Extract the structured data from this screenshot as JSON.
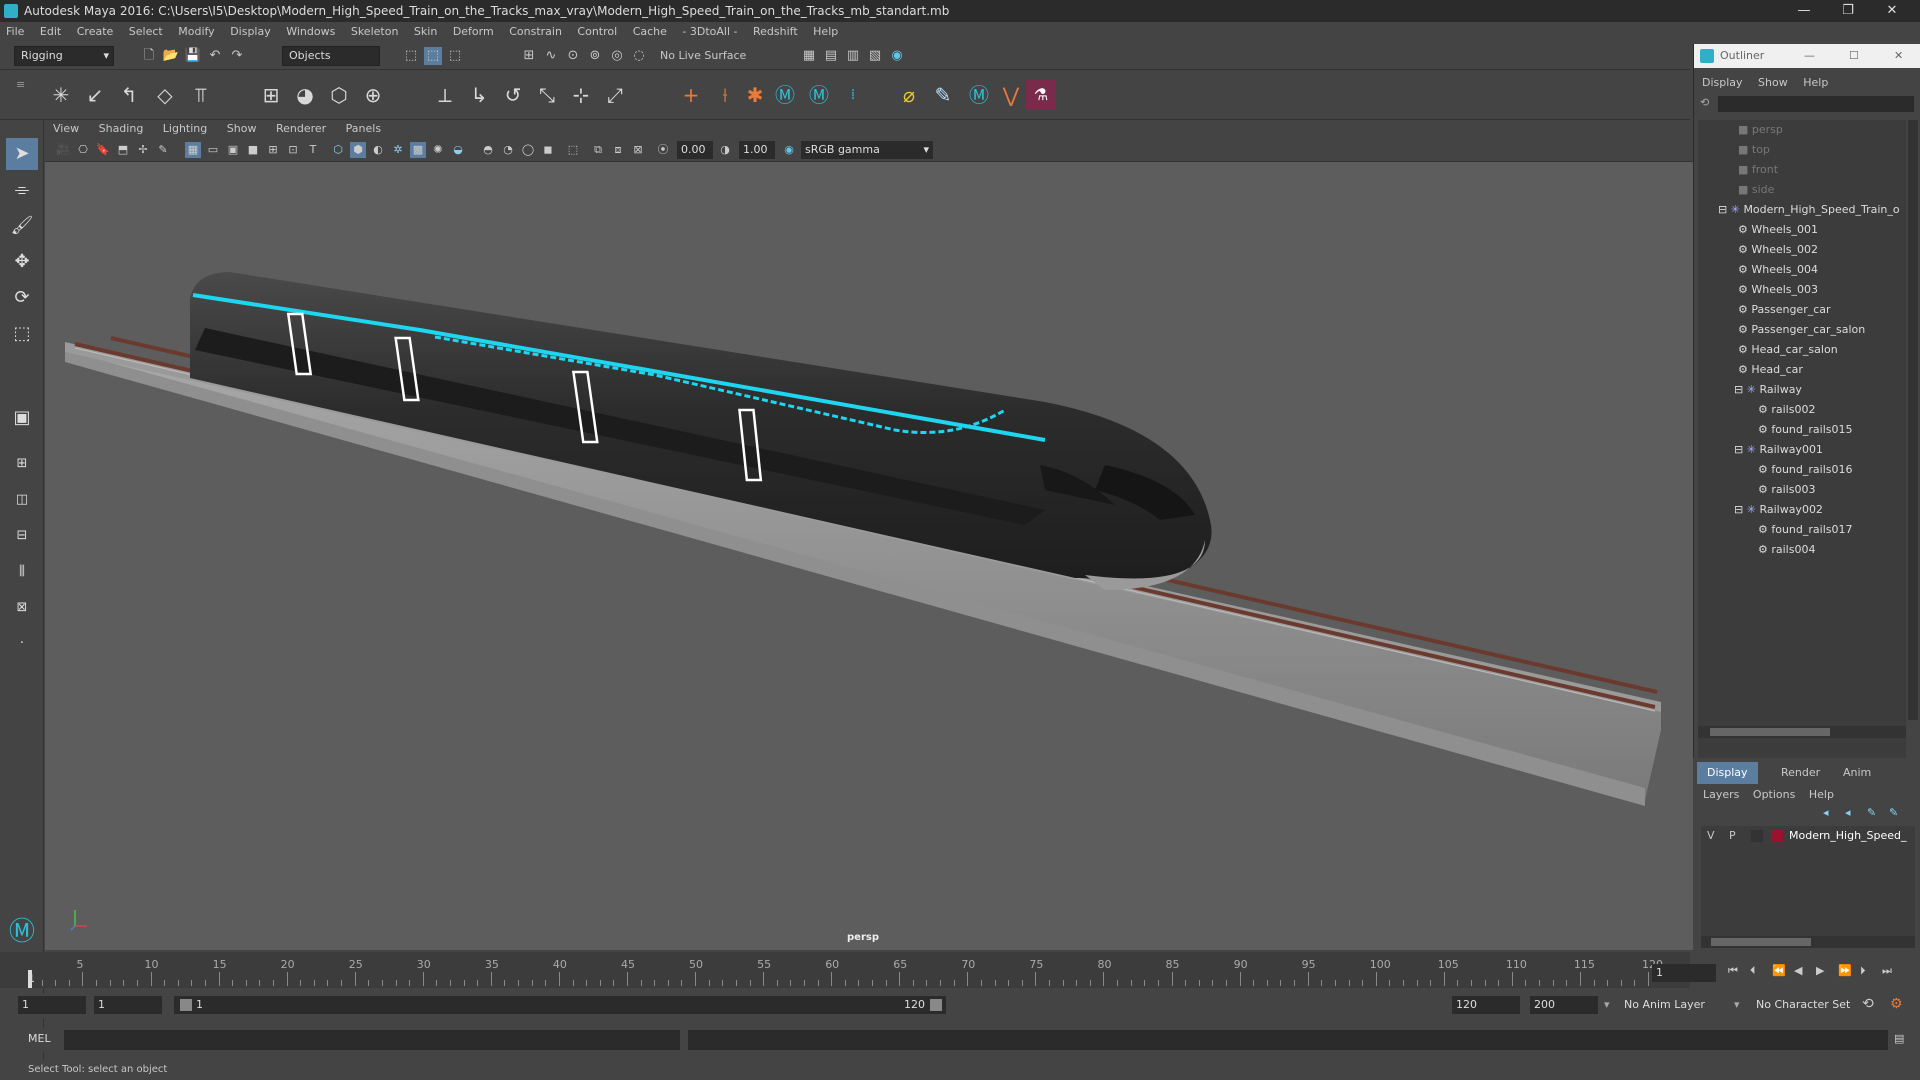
{
  "titlebar": {
    "title": "Autodesk Maya 2016: C:\\Users\\I5\\Desktop\\Modern_High_Speed_Train_on_the_Tracks_max_vray\\Modern_High_Speed_Train_on_the_Tracks_mb_standart.mb"
  },
  "menubar": [
    "File",
    "Edit",
    "Create",
    "Select",
    "Modify",
    "Display",
    "Windows",
    "Skeleton",
    "Skin",
    "Deform",
    "Constrain",
    "Control",
    "Cache",
    "- 3DtoAll -",
    "Redshift",
    "Help"
  ],
  "statusline": {
    "menuset": "Rigging",
    "selection_mode": "Objects",
    "live_surface": "No Live Surface"
  },
  "viewport": {
    "menu": [
      "View",
      "Shading",
      "Lighting",
      "Show",
      "Renderer",
      "Panels"
    ],
    "near_value": "0.00",
    "far_value": "1.00",
    "color_space": "sRGB gamma",
    "camera_label": "persp"
  },
  "outliner": {
    "title": "Outliner",
    "menu": [
      "Display",
      "Show",
      "Help"
    ],
    "items": [
      {
        "label": "persp",
        "dim": true
      },
      {
        "label": "top",
        "dim": true
      },
      {
        "label": "front",
        "dim": true
      },
      {
        "label": "side",
        "dim": true
      },
      {
        "label": "Modern_High_Speed_Train_o"
      },
      {
        "label": "Wheels_001"
      },
      {
        "label": "Wheels_002"
      },
      {
        "label": "Wheels_004"
      },
      {
        "label": "Wheels_003"
      },
      {
        "label": "Passenger_car"
      },
      {
        "label": "Passenger_car_salon"
      },
      {
        "label": "Head_car_salon"
      },
      {
        "label": "Head_car"
      },
      {
        "label": "Railway"
      },
      {
        "label": "rails002"
      },
      {
        "label": "found_rails015"
      },
      {
        "label": "Railway001"
      },
      {
        "label": "found_rails016"
      },
      {
        "label": "rails003"
      },
      {
        "label": "Railway002"
      },
      {
        "label": "found_rails017"
      },
      {
        "label": "rails004"
      }
    ]
  },
  "layers": {
    "tabs": [
      "Display",
      "Render",
      "Anim"
    ],
    "menu": [
      "Layers",
      "Options",
      "Help"
    ],
    "row": {
      "v": "V",
      "p": "P",
      "name": "Modern_High_Speed_",
      "color": "#9c1030"
    }
  },
  "timeline": {
    "ticks": [
      "5",
      "10",
      "15",
      "20",
      "25",
      "30",
      "35",
      "40",
      "45",
      "50",
      "55",
      "60",
      "65",
      "70",
      "75",
      "80",
      "85",
      "90",
      "95",
      "100",
      "105",
      "110",
      "115",
      "120"
    ],
    "current_frame": "1",
    "start_tick": "1"
  },
  "range": {
    "start": "1",
    "anim_start": "1",
    "slider_start": "1",
    "slider_end": "120",
    "end": "120",
    "anim_end": "200",
    "anim_layer": "No Anim Layer",
    "char_set": "No Character Set"
  },
  "cmdline": {
    "label": "MEL"
  },
  "helpline": {
    "text": "Select Tool: select an object"
  },
  "colors": {
    "accent_cyan": "#1ed6f0",
    "viewport_bg": "#5d5d5d",
    "layer_color": "#9c1030"
  }
}
